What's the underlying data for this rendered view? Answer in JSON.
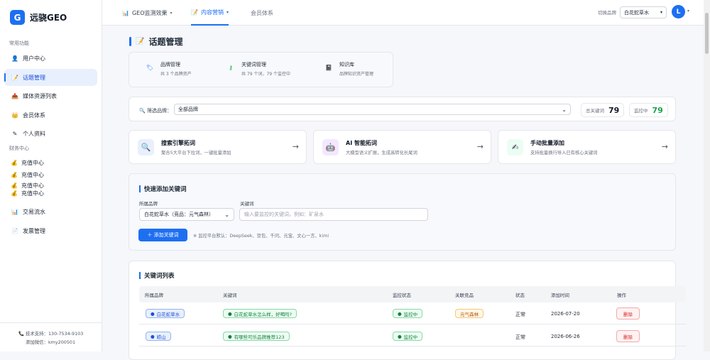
{
  "app": {
    "logo_letter": "G",
    "name": "远骁GEO"
  },
  "sidebar": {
    "section_common": "常用功能",
    "items": [
      {
        "icon": "👤",
        "label": "用户中心"
      },
      {
        "icon": "📝",
        "label": "话题管理"
      },
      {
        "icon": "📤",
        "label": "媒体资源列表"
      },
      {
        "icon": "👑",
        "label": "会员体系"
      },
      {
        "icon": "✎",
        "label": "个人资料"
      }
    ],
    "section_finance": "财务中心",
    "recharge": [
      "充值中心",
      "充值中心",
      "充值中心",
      "充值中心"
    ],
    "recharge_icon": "💰",
    "items2": [
      {
        "icon": "📊",
        "label": "交易流水"
      },
      {
        "icon": "📄",
        "label": "发票管理"
      }
    ],
    "support_phone": "技术支持：130-7534-9103",
    "support_wechat": "添加微信：kmy200501"
  },
  "topbar": {
    "tabs": [
      {
        "icon": "📊",
        "label": "GEO监测效果",
        "caret": "▾"
      },
      {
        "icon": "📝",
        "label": "内容营销",
        "caret": "▾"
      },
      {
        "icon": "",
        "label": "会员体系",
        "caret": ""
      }
    ],
    "brand_switch_label": "切换品牌",
    "brand_value": "白花蛇草水",
    "avatar_letter": "L"
  },
  "page": {
    "title": "话题管理",
    "mini_cards": [
      {
        "title": "品牌管理",
        "sub": "共 3 个品牌资产"
      },
      {
        "title": "关键词管理",
        "sub": "共 79 个词，79 个监控中"
      },
      {
        "title": "知识库",
        "sub": "品牌知识资产管理"
      }
    ],
    "filter": {
      "label": "筛选品牌：",
      "value": "全部品牌"
    },
    "stats": {
      "total_label": "总关键词",
      "total": "79",
      "monitor_label": "监控中",
      "monitor": "79"
    },
    "features": [
      {
        "title": "搜索引擎拓词",
        "sub": "聚合5大平台下拉词，一键批量添加",
        "arrow": "→"
      },
      {
        "title": "AI 智能拓词",
        "sub": "大模型语义扩展，生成高转化长尾词",
        "arrow": "→"
      },
      {
        "title": "手动批量添加",
        "sub": "支持批量换行导入已有核心关键词",
        "arrow": "→"
      }
    ],
    "quick_add": {
      "title": "快速添加关键词",
      "brand_label": "所属品牌",
      "brand_value": "白花蛇草水（竞品：元气森林）",
      "keyword_label": "关键词",
      "keyword_placeholder": "输入要监控的关键词，例如：矿泉水",
      "button": "＋ 添加关键词",
      "hint": "※ 监控平台默认：DeepSeek、豆包、千问、元宝、文心一言、kimi"
    },
    "table": {
      "title": "关键词列表",
      "headers": [
        "所属品牌",
        "关键词",
        "监控状态",
        "关联竞品",
        "状态",
        "添加时间",
        "操作"
      ],
      "rows": [
        {
          "brand": "白花蛇草水",
          "keyword": "白花蛇草水怎么样，好喝吗?",
          "monitor": "监控中",
          "competitor": "元气森林",
          "status": "正常",
          "date": "2026-07-20",
          "action": "删除"
        },
        {
          "brand": "崂山",
          "keyword": "有哪些可乐品牌推荐123",
          "monitor": "监控中",
          "competitor": "",
          "status": "正常",
          "date": "2026-06-26",
          "action": "删除"
        }
      ]
    }
  }
}
